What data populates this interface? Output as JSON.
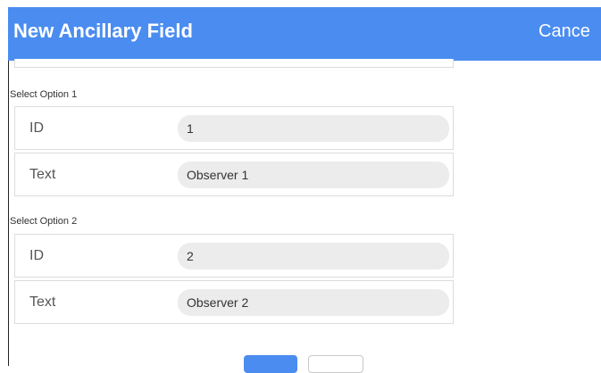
{
  "header": {
    "title": "New Ancillary Field",
    "cancel_label": "Cance"
  },
  "options": [
    {
      "section_label": "Select Option 1",
      "id_label": "ID",
      "id_value": "1",
      "text_label": "Text",
      "text_value": "Observer 1"
    },
    {
      "section_label": "Select Option 2",
      "id_label": "ID",
      "id_value": "2",
      "text_label": "Text",
      "text_value": "Observer 2"
    }
  ],
  "colors": {
    "header_bg": "#4b8cf0",
    "field_bg": "#ececec",
    "primary_button": "#4b8cf0"
  }
}
